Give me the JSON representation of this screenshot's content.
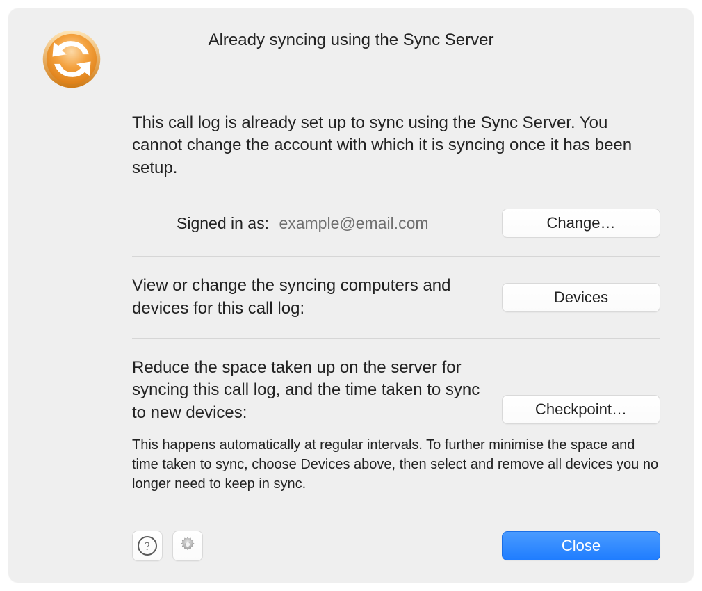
{
  "title": "Already syncing using the Sync Server",
  "intro": "This call log is already set up to sync using the Sync Server. You cannot change the account with which it is syncing once it has been setup.",
  "signed_in": {
    "label": "Signed in as:",
    "email": "example@email.com",
    "change_button": "Change…"
  },
  "devices": {
    "text": "View or change the syncing computers and devices for this call log:",
    "button": "Devices"
  },
  "checkpoint": {
    "text": "Reduce the space taken up on the server for syncing this call log, and the time taken to sync to new devices:",
    "button": "Checkpoint…",
    "note": "This happens automatically at regular intervals. To further minimise the space and time taken to sync, choose Devices above, then select and remove all devices you no longer need to keep in sync."
  },
  "footer": {
    "help_glyph": "?",
    "close_button": "Close"
  }
}
